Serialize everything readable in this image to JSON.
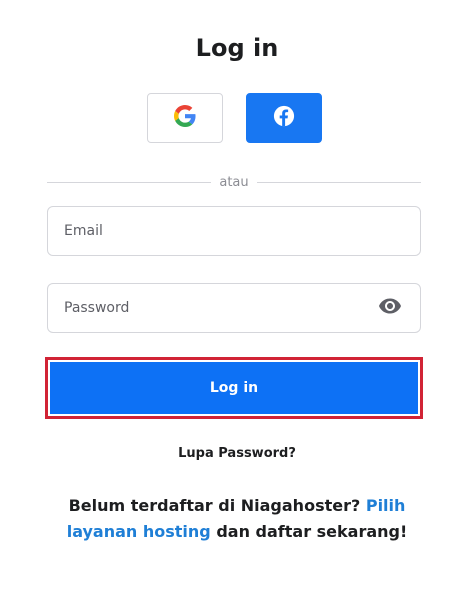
{
  "page": {
    "title": "Log in",
    "divider_text": "atau"
  },
  "social": {
    "google_icon": "google-icon",
    "facebook_icon": "facebook-icon",
    "facebook_color": "#1877f2"
  },
  "form": {
    "email_placeholder": "Email",
    "password_placeholder": "Password",
    "password_toggle_icon": "eye-icon",
    "login_label": "Log in",
    "login_color": "#0d71f5",
    "highlight_color": "#d12335"
  },
  "links": {
    "forgot_password": "Lupa Password?",
    "signup_prefix": "Belum terdaftar di Niagahoster?",
    "signup_link": "Pilih layanan hosting",
    "signup_suffix": "dan daftar sekarang!",
    "link_color": "#1f7fd6"
  }
}
